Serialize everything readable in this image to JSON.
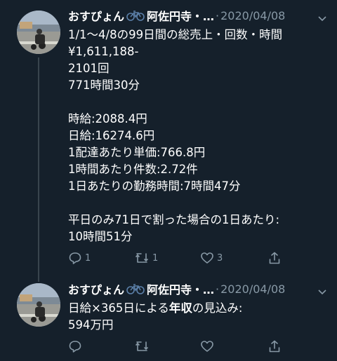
{
  "tweets": [
    {
      "display_name": "おすぴょん",
      "display_name_2": "阿佐円寺・…",
      "separator": "·",
      "date": "2020/04/08",
      "lines": [
        "1/1〜4/8の99日間の総売上・回数・時間",
        "¥1,611,188-",
        "2101回",
        "771時間30分",
        "",
        "時給:2088.4円",
        "日給:16274.6円",
        "1配達あたり単価:766.8円",
        "1時間あたり件数:2.72件",
        "1日あたりの勤務時間:7時間47分",
        "",
        "平日のみ71日で割った場合の1日あたり:",
        "10時間51分"
      ],
      "reply_count": "1",
      "retweet_count": "1",
      "like_count": "3"
    },
    {
      "display_name": "おすぴょん",
      "display_name_2": "阿佐円寺・…",
      "separator": "·",
      "date": "2020/04/08",
      "line1_pre": "日給×365日による",
      "line1_bold": "年収",
      "line1_post": "の見込み:",
      "line2": "594万円",
      "reply_count": "",
      "retweet_count": "",
      "like_count": ""
    }
  ],
  "icons": {
    "bike": "bicycle-icon",
    "caret": "chevron-down-icon",
    "reply": "reply-icon",
    "retweet": "retweet-icon",
    "like": "heart-icon",
    "share": "share-icon"
  },
  "colors": {
    "background": "#15202b",
    "text": "#ffffff",
    "muted": "#8899a6",
    "divider": "#38444d"
  }
}
